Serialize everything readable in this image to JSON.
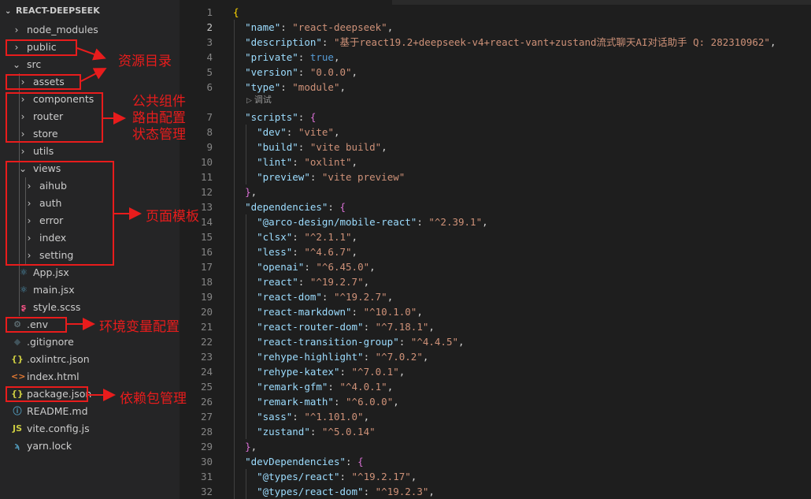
{
  "explorer": {
    "root_label": "REACT-DEEPSEEK",
    "items": [
      {
        "label": "node_modules",
        "kind": "folder",
        "open": false,
        "depth": 0,
        "icon": "chevron-right"
      },
      {
        "label": "public",
        "kind": "folder",
        "open": false,
        "depth": 0,
        "icon": "chevron-right"
      },
      {
        "label": "src",
        "kind": "folder",
        "open": true,
        "depth": 0,
        "icon": "chevron-down"
      },
      {
        "label": "assets",
        "kind": "folder",
        "open": false,
        "depth": 1,
        "icon": "chevron-right"
      },
      {
        "label": "components",
        "kind": "folder",
        "open": false,
        "depth": 1,
        "icon": "chevron-right"
      },
      {
        "label": "router",
        "kind": "folder",
        "open": false,
        "depth": 1,
        "icon": "chevron-right"
      },
      {
        "label": "store",
        "kind": "folder",
        "open": false,
        "depth": 1,
        "icon": "chevron-right"
      },
      {
        "label": "utils",
        "kind": "folder",
        "open": false,
        "depth": 1,
        "icon": "chevron-right"
      },
      {
        "label": "views",
        "kind": "folder",
        "open": true,
        "depth": 1,
        "icon": "chevron-down"
      },
      {
        "label": "aihub",
        "kind": "folder",
        "open": false,
        "depth": 2,
        "icon": "chevron-right"
      },
      {
        "label": "auth",
        "kind": "folder",
        "open": false,
        "depth": 2,
        "icon": "chevron-right"
      },
      {
        "label": "error",
        "kind": "folder",
        "open": false,
        "depth": 2,
        "icon": "chevron-right"
      },
      {
        "label": "index",
        "kind": "folder",
        "open": false,
        "depth": 2,
        "icon": "chevron-right"
      },
      {
        "label": "setting",
        "kind": "folder",
        "open": false,
        "depth": 2,
        "icon": "chevron-right"
      },
      {
        "label": "App.jsx",
        "kind": "file",
        "depth": 1,
        "icon": "react-icon"
      },
      {
        "label": "main.jsx",
        "kind": "file",
        "depth": 1,
        "icon": "react-icon"
      },
      {
        "label": "style.scss",
        "kind": "file",
        "depth": 1,
        "icon": "sass-icon"
      },
      {
        "label": ".env",
        "kind": "file",
        "depth": 0,
        "icon": "gear-icon"
      },
      {
        "label": ".gitignore",
        "kind": "file",
        "depth": 0,
        "icon": "git-icon"
      },
      {
        "label": ".oxlintrc.json",
        "kind": "file",
        "depth": 0,
        "icon": "json-icon"
      },
      {
        "label": "index.html",
        "kind": "file",
        "depth": 0,
        "icon": "html-icon"
      },
      {
        "label": "package.json",
        "kind": "file",
        "depth": 0,
        "icon": "json-icon"
      },
      {
        "label": "README.md",
        "kind": "file",
        "depth": 0,
        "icon": "info-icon"
      },
      {
        "label": "vite.config.js",
        "kind": "file",
        "depth": 0,
        "icon": "js-icon"
      },
      {
        "label": "yarn.lock",
        "kind": "file",
        "depth": 0,
        "icon": "yarn-icon"
      }
    ]
  },
  "icon_glyphs": {
    "chevron-right": "›",
    "chevron-down": "⌄",
    "react-icon": "⚛",
    "sass-icon": "ʂ",
    "gear-icon": "⚙",
    "git-icon": "◆",
    "json-icon": "{}",
    "html-icon": "<>",
    "info-icon": "ⓘ",
    "js-icon": "JS",
    "yarn-icon": "ϡ"
  },
  "icon_colors": {
    "react-icon": "#519aba",
    "sass-icon": "#f55385",
    "gear-icon": "#6d8086",
    "git-icon": "#41535b",
    "json-icon": "#cbcb41",
    "html-icon": "#e37933",
    "info-icon": "#519aba",
    "js-icon": "#cbcb41",
    "yarn-icon": "#519aba"
  },
  "annotations": {
    "assets": "资源目录",
    "public_services": [
      "公共组件",
      "路由配置",
      "状态管理"
    ],
    "views": "页面模板",
    "env": "环境变量配置",
    "package": "依赖包管理"
  },
  "editor": {
    "active_line": 2,
    "codelens": "调试",
    "lines": [
      {
        "n": "1",
        "tokens": [
          [
            "br",
            "{"
          ]
        ]
      },
      {
        "n": "2",
        "tokens": [
          [
            "p",
            "  "
          ],
          [
            "k",
            "\"name\""
          ],
          [
            "p",
            ": "
          ],
          [
            "s",
            "\"react-deepseek\""
          ],
          [
            "p",
            ","
          ]
        ]
      },
      {
        "n": "3",
        "tokens": [
          [
            "p",
            "  "
          ],
          [
            "k",
            "\"description\""
          ],
          [
            "p",
            ": "
          ],
          [
            "s",
            "\"基于react19.2+deepseek-v4+react-vant+zustand流式聊天AI对话助手 Q: 282310962\""
          ],
          [
            "p",
            ","
          ]
        ]
      },
      {
        "n": "4",
        "tokens": [
          [
            "p",
            "  "
          ],
          [
            "k",
            "\"private\""
          ],
          [
            "p",
            ": "
          ],
          [
            "b",
            "true"
          ],
          [
            "p",
            ","
          ]
        ]
      },
      {
        "n": "5",
        "tokens": [
          [
            "p",
            "  "
          ],
          [
            "k",
            "\"version\""
          ],
          [
            "p",
            ": "
          ],
          [
            "s",
            "\"0.0.0\""
          ],
          [
            "p",
            ","
          ]
        ]
      },
      {
        "n": "6",
        "tokens": [
          [
            "p",
            "  "
          ],
          [
            "k",
            "\"type\""
          ],
          [
            "p",
            ": "
          ],
          [
            "s",
            "\"module\""
          ],
          [
            "p",
            ","
          ]
        ]
      },
      {
        "n": "7",
        "tokens": [
          [
            "p",
            "  "
          ],
          [
            "k",
            "\"scripts\""
          ],
          [
            "p",
            ": "
          ],
          [
            "br2",
            "{"
          ]
        ]
      },
      {
        "n": "8",
        "tokens": [
          [
            "p",
            "    "
          ],
          [
            "k",
            "\"dev\""
          ],
          [
            "p",
            ": "
          ],
          [
            "s",
            "\"vite\""
          ],
          [
            "p",
            ","
          ]
        ]
      },
      {
        "n": "9",
        "tokens": [
          [
            "p",
            "    "
          ],
          [
            "k",
            "\"build\""
          ],
          [
            "p",
            ": "
          ],
          [
            "s",
            "\"vite build\""
          ],
          [
            "p",
            ","
          ]
        ]
      },
      {
        "n": "10",
        "tokens": [
          [
            "p",
            "    "
          ],
          [
            "k",
            "\"lint\""
          ],
          [
            "p",
            ": "
          ],
          [
            "s",
            "\"oxlint\""
          ],
          [
            "p",
            ","
          ]
        ]
      },
      {
        "n": "11",
        "tokens": [
          [
            "p",
            "    "
          ],
          [
            "k",
            "\"preview\""
          ],
          [
            "p",
            ": "
          ],
          [
            "s",
            "\"vite preview\""
          ]
        ]
      },
      {
        "n": "12",
        "tokens": [
          [
            "p",
            "  "
          ],
          [
            "br2",
            "}"
          ],
          [
            "p",
            ","
          ]
        ]
      },
      {
        "n": "13",
        "tokens": [
          [
            "p",
            "  "
          ],
          [
            "k",
            "\"dependencies\""
          ],
          [
            "p",
            ": "
          ],
          [
            "br2",
            "{"
          ]
        ]
      },
      {
        "n": "14",
        "tokens": [
          [
            "p",
            "    "
          ],
          [
            "k",
            "\"@arco-design/mobile-react\""
          ],
          [
            "p",
            ": "
          ],
          [
            "s",
            "\"^2.39.1\""
          ],
          [
            "p",
            ","
          ]
        ]
      },
      {
        "n": "15",
        "tokens": [
          [
            "p",
            "    "
          ],
          [
            "k",
            "\"clsx\""
          ],
          [
            "p",
            ": "
          ],
          [
            "s",
            "\"^2.1.1\""
          ],
          [
            "p",
            ","
          ]
        ]
      },
      {
        "n": "16",
        "tokens": [
          [
            "p",
            "    "
          ],
          [
            "k",
            "\"less\""
          ],
          [
            "p",
            ": "
          ],
          [
            "s",
            "\"^4.6.7\""
          ],
          [
            "p",
            ","
          ]
        ]
      },
      {
        "n": "17",
        "tokens": [
          [
            "p",
            "    "
          ],
          [
            "k",
            "\"openai\""
          ],
          [
            "p",
            ": "
          ],
          [
            "s",
            "\"^6.45.0\""
          ],
          [
            "p",
            ","
          ]
        ]
      },
      {
        "n": "18",
        "tokens": [
          [
            "p",
            "    "
          ],
          [
            "k",
            "\"react\""
          ],
          [
            "p",
            ": "
          ],
          [
            "s",
            "\"^19.2.7\""
          ],
          [
            "p",
            ","
          ]
        ]
      },
      {
        "n": "19",
        "tokens": [
          [
            "p",
            "    "
          ],
          [
            "k",
            "\"react-dom\""
          ],
          [
            "p",
            ": "
          ],
          [
            "s",
            "\"^19.2.7\""
          ],
          [
            "p",
            ","
          ]
        ]
      },
      {
        "n": "20",
        "tokens": [
          [
            "p",
            "    "
          ],
          [
            "k",
            "\"react-markdown\""
          ],
          [
            "p",
            ": "
          ],
          [
            "s",
            "\"^10.1.0\""
          ],
          [
            "p",
            ","
          ]
        ]
      },
      {
        "n": "21",
        "tokens": [
          [
            "p",
            "    "
          ],
          [
            "k",
            "\"react-router-dom\""
          ],
          [
            "p",
            ": "
          ],
          [
            "s",
            "\"^7.18.1\""
          ],
          [
            "p",
            ","
          ]
        ]
      },
      {
        "n": "22",
        "tokens": [
          [
            "p",
            "    "
          ],
          [
            "k",
            "\"react-transition-group\""
          ],
          [
            "p",
            ": "
          ],
          [
            "s",
            "\"^4.4.5\""
          ],
          [
            "p",
            ","
          ]
        ]
      },
      {
        "n": "23",
        "tokens": [
          [
            "p",
            "    "
          ],
          [
            "k",
            "\"rehype-highlight\""
          ],
          [
            "p",
            ": "
          ],
          [
            "s",
            "\"^7.0.2\""
          ],
          [
            "p",
            ","
          ]
        ]
      },
      {
        "n": "24",
        "tokens": [
          [
            "p",
            "    "
          ],
          [
            "k",
            "\"rehype-katex\""
          ],
          [
            "p",
            ": "
          ],
          [
            "s",
            "\"^7.0.1\""
          ],
          [
            "p",
            ","
          ]
        ]
      },
      {
        "n": "25",
        "tokens": [
          [
            "p",
            "    "
          ],
          [
            "k",
            "\"remark-gfm\""
          ],
          [
            "p",
            ": "
          ],
          [
            "s",
            "\"^4.0.1\""
          ],
          [
            "p",
            ","
          ]
        ]
      },
      {
        "n": "26",
        "tokens": [
          [
            "p",
            "    "
          ],
          [
            "k",
            "\"remark-math\""
          ],
          [
            "p",
            ": "
          ],
          [
            "s",
            "\"^6.0.0\""
          ],
          [
            "p",
            ","
          ]
        ]
      },
      {
        "n": "27",
        "tokens": [
          [
            "p",
            "    "
          ],
          [
            "k",
            "\"sass\""
          ],
          [
            "p",
            ": "
          ],
          [
            "s",
            "\"^1.101.0\""
          ],
          [
            "p",
            ","
          ]
        ]
      },
      {
        "n": "28",
        "tokens": [
          [
            "p",
            "    "
          ],
          [
            "k",
            "\"zustand\""
          ],
          [
            "p",
            ": "
          ],
          [
            "s",
            "\"^5.0.14\""
          ]
        ]
      },
      {
        "n": "29",
        "tokens": [
          [
            "p",
            "  "
          ],
          [
            "br2",
            "}"
          ],
          [
            "p",
            ","
          ]
        ]
      },
      {
        "n": "30",
        "tokens": [
          [
            "p",
            "  "
          ],
          [
            "k",
            "\"devDependencies\""
          ],
          [
            "p",
            ": "
          ],
          [
            "br2",
            "{"
          ]
        ]
      },
      {
        "n": "31",
        "tokens": [
          [
            "p",
            "    "
          ],
          [
            "k",
            "\"@types/react\""
          ],
          [
            "p",
            ": "
          ],
          [
            "s",
            "\"^19.2.17\""
          ],
          [
            "p",
            ","
          ]
        ]
      },
      {
        "n": "32",
        "tokens": [
          [
            "p",
            "    "
          ],
          [
            "k",
            "\"@types/react-dom\""
          ],
          [
            "p",
            ": "
          ],
          [
            "s",
            "\"^19.2.3\""
          ],
          [
            "p",
            ","
          ]
        ]
      }
    ]
  }
}
